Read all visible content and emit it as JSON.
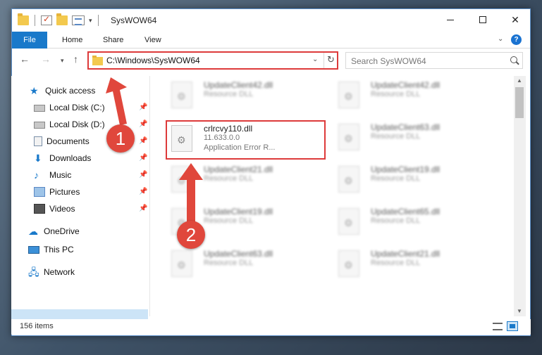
{
  "window": {
    "title": "SysWOW64"
  },
  "ribbon": {
    "tabs": [
      "File",
      "Home",
      "Share",
      "View"
    ],
    "help": "?"
  },
  "address": {
    "path": "C:\\Windows\\SysWOW64",
    "search_placeholder": "Search SysWOW64"
  },
  "nav": {
    "items": [
      {
        "label": "Quick access",
        "icon": "star-icon"
      },
      {
        "label": "Local Disk (C:)",
        "icon": "drive-icon",
        "pinned": true
      },
      {
        "label": "Local Disk (D:)",
        "icon": "drive-icon",
        "pinned": true
      },
      {
        "label": "Documents",
        "icon": "documents-icon",
        "pinned": true
      },
      {
        "label": "Downloads",
        "icon": "download-icon",
        "pinned": true
      },
      {
        "label": "Music",
        "icon": "music-icon",
        "pinned": true
      },
      {
        "label": "Pictures",
        "icon": "pictures-icon",
        "pinned": true
      },
      {
        "label": "Videos",
        "icon": "videos-icon",
        "pinned": true
      },
      {
        "label": "OneDrive",
        "icon": "cloud-icon"
      },
      {
        "label": "This PC",
        "icon": "computer-icon",
        "selected": true
      },
      {
        "label": "Network",
        "icon": "network-icon"
      }
    ]
  },
  "files": {
    "highlighted": {
      "name": "crlrcvy110.dll",
      "version": "11.633.0.0",
      "description": "Application Error R..."
    },
    "left": [
      {
        "name": "UpdateClient42.dll",
        "desc": "Resource DLL"
      },
      {
        "name": "UpdateClient21.dll",
        "desc": "Resource DLL"
      },
      {
        "name": "UpdateClient19.dll",
        "desc": "Resource DLL"
      },
      {
        "name": "UpdateClient63.dll",
        "desc": "Resource DLL"
      }
    ],
    "right": [
      {
        "name": "UpdateClient42.dll",
        "desc": "Resource DLL"
      },
      {
        "name": "UpdateClient63.dll",
        "desc": "Resource DLL"
      },
      {
        "name": "UpdateClient19.dll",
        "desc": "Resource DLL"
      },
      {
        "name": "UpdateClient65.dll",
        "desc": "Resource DLL"
      },
      {
        "name": "UpdateClient21.dll",
        "desc": "Resource DLL"
      }
    ]
  },
  "status": {
    "count": "156 items"
  },
  "annotations": {
    "step1": "1",
    "step2": "2",
    "color": "#e0473c"
  }
}
